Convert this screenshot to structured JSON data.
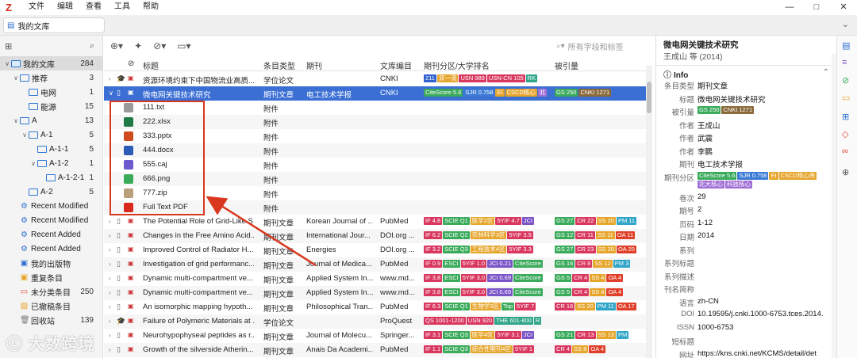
{
  "menubar": {
    "logo": "Z",
    "items": [
      "文件",
      "编辑",
      "查看",
      "工具",
      "帮助"
    ],
    "controls": [
      "—",
      "□",
      "✕"
    ]
  },
  "tab": {
    "label": "我的文库"
  },
  "left": {
    "collections": [
      {
        "label": "我的文库",
        "count": "284",
        "tw": "∨",
        "kind": "lib",
        "indent": 0,
        "sel": true
      },
      {
        "label": "推荐",
        "count": "3",
        "tw": "∨",
        "kind": "folder",
        "indent": 1
      },
      {
        "label": "电网",
        "count": "1",
        "tw": "",
        "kind": "folder",
        "indent": 2
      },
      {
        "label": "能源",
        "count": "15",
        "tw": "",
        "kind": "folder",
        "indent": 2
      },
      {
        "label": "A",
        "count": "13",
        "tw": "∨",
        "kind": "folder",
        "indent": 1
      },
      {
        "label": "A-1",
        "count": "5",
        "tw": "∨",
        "kind": "folder",
        "indent": 2
      },
      {
        "label": "A-1-1",
        "count": "5",
        "tw": "",
        "kind": "folder",
        "indent": 3
      },
      {
        "label": "A-1-2",
        "count": "1",
        "tw": "∨",
        "kind": "folder",
        "indent": 3
      },
      {
        "label": "A-1-2-1",
        "count": "1",
        "tw": "",
        "kind": "folder",
        "indent": 4
      },
      {
        "label": "A-2",
        "count": "5",
        "tw": "",
        "kind": "folder",
        "indent": 2
      },
      {
        "label": "Recent Modified",
        "count": "",
        "tw": "",
        "kind": "saved",
        "indent": 1
      },
      {
        "label": "Recent Modified",
        "count": "",
        "tw": "",
        "kind": "saved",
        "indent": 1
      },
      {
        "label": "Recent Added",
        "count": "",
        "tw": "",
        "kind": "saved",
        "indent": 1
      },
      {
        "label": "Recent Added",
        "count": "",
        "tw": "",
        "kind": "saved",
        "indent": 1
      },
      {
        "label": "我的出版物",
        "count": "",
        "tw": "",
        "kind": "pub",
        "indent": 1
      },
      {
        "label": "重复条目",
        "count": "",
        "tw": "",
        "kind": "dup",
        "indent": 1
      },
      {
        "label": "未分类条目",
        "count": "250",
        "tw": "",
        "kind": "unf",
        "indent": 1
      },
      {
        "label": "已撤稿条目",
        "count": "",
        "tw": "",
        "kind": "ret",
        "indent": 1
      },
      {
        "label": "回收站",
        "count": "139",
        "tw": "",
        "kind": "trash",
        "indent": 1
      }
    ]
  },
  "middle": {
    "search_placeholder": "所有字段和标签",
    "columns": {
      "title": "标题",
      "type": "条目类型",
      "journal": "期刊",
      "catalog": "文库编目",
      "rank": "期刊分区/大学排名",
      "cited": "被引量"
    },
    "rows": [
      {
        "kind": "item",
        "tw": "›",
        "title": "资源环境约束下中国物流业高质...",
        "type": "学位论文",
        "journal": "",
        "catalog": "CNKI",
        "rank": [
          [
            "211",
            "#2f5fd0"
          ],
          [
            "双一流",
            "#e6a52b"
          ],
          [
            "USN 989",
            "#d9375f"
          ],
          [
            "USN-CN 105",
            "#d9375f"
          ],
          [
            "RK",
            "#2fa58a"
          ]
        ],
        "cited": []
      },
      {
        "kind": "item",
        "tw": "∨",
        "sel": true,
        "title": "微电网关键技术研究",
        "type": "期刊文章",
        "journal": "电工技术学报",
        "catalog": "CNKI",
        "rank": [
          [
            "CiteScore 5.6",
            "#3aaa5b"
          ],
          [
            "SJR 0.758",
            "#3b7bd6"
          ],
          [
            "EI",
            "#e6a52b"
          ],
          [
            "CSCD核心",
            "#e6a52b"
          ],
          [
            "北",
            "#a06fd6"
          ]
        ],
        "cited": [
          [
            "GS 250",
            "#3aaa5b"
          ],
          [
            "CNKI 1271",
            "#8a6a3a"
          ]
        ]
      },
      {
        "kind": "att",
        "title": "111.txt",
        "type": "附件",
        "icon": "#9a9a9a"
      },
      {
        "kind": "att",
        "title": "222.xlsx",
        "type": "附件",
        "icon": "#1f7a46"
      },
      {
        "kind": "att",
        "title": "333.pptx",
        "type": "附件",
        "icon": "#d04a1f"
      },
      {
        "kind": "att",
        "title": "444.docx",
        "type": "附件",
        "icon": "#2b5cb8"
      },
      {
        "kind": "att",
        "title": "555.caj",
        "type": "附件",
        "icon": "#6a5acd"
      },
      {
        "kind": "att",
        "title": "666.png",
        "type": "附件",
        "icon": "#3aaa5b"
      },
      {
        "kind": "att",
        "title": "777.zip",
        "type": "附件",
        "icon": "#b8a07a"
      },
      {
        "kind": "att",
        "title": "Full Text PDF",
        "type": "附件",
        "icon": "#d9281e"
      },
      {
        "kind": "item",
        "tw": "›",
        "title": "The Potential Role of Grid-Like S...",
        "type": "期刊文章",
        "journal": "Korean Journal of ...",
        "catalog": "PubMed",
        "rank": [
          [
            "IF 4.8",
            "#d9375f"
          ],
          [
            "SCIE Q1",
            "#3aaa5b"
          ],
          [
            "医学2区",
            "#e6a52b"
          ],
          [
            "5YIF 4.7",
            "#d9375f"
          ],
          [
            "JCI",
            "#7a55c8"
          ]
        ],
        "cited": [
          [
            "GS 27",
            "#3aaa5b"
          ],
          [
            "CR 22",
            "#d9375f"
          ],
          [
            "SS 20",
            "#e6a52b"
          ],
          [
            "PM 11",
            "#2fa5c8"
          ]
        ]
      },
      {
        "kind": "item",
        "tw": "›",
        "title": "Changes in the Free Amino Acid...",
        "type": "期刊文章",
        "journal": "International Jour...",
        "catalog": "DOI.org ...",
        "rank": [
          [
            "IF 6.2",
            "#d9375f"
          ],
          [
            "SCIE Q2",
            "#3aaa5b"
          ],
          [
            "农林科学3区",
            "#e6a52b"
          ],
          [
            "5YIF 3.5",
            "#d9375f"
          ]
        ],
        "cited": [
          [
            "GS 12",
            "#3aaa5b"
          ],
          [
            "CR 11",
            "#d9375f"
          ],
          [
            "SS 11",
            "#e6a52b"
          ],
          [
            "OA 11",
            "#e0402a"
          ]
        ]
      },
      {
        "kind": "item",
        "tw": "›",
        "title": "Improved Control of Radiator H...",
        "type": "期刊文章",
        "journal": "Energies",
        "catalog": "DOI.org ...",
        "rank": [
          [
            "IF 3.2",
            "#d9375f"
          ],
          [
            "SCIE Q3",
            "#3aaa5b"
          ],
          [
            "工程技术4区",
            "#e6a52b"
          ],
          [
            "5YIF 3.3",
            "#d9375f"
          ]
        ],
        "cited": [
          [
            "GS 27",
            "#3aaa5b"
          ],
          [
            "CR 23",
            "#d9375f"
          ],
          [
            "SS 20",
            "#e6a52b"
          ],
          [
            "OA 20",
            "#e0402a"
          ]
        ]
      },
      {
        "kind": "item",
        "tw": "›",
        "title": "Investigation of grid performanc...",
        "type": "期刊文章",
        "journal": "Journal of Medica...",
        "catalog": "PubMed",
        "rank": [
          [
            "IF 0.9",
            "#d9375f"
          ],
          [
            "ESCI",
            "#3aaa5b"
          ],
          [
            "5YIF 1.0",
            "#d9375f"
          ],
          [
            "JCI 0.21",
            "#7a55c8"
          ],
          [
            "CiteScore",
            "#3aaa5b"
          ]
        ],
        "cited": [
          [
            "GS 16",
            "#3aaa5b"
          ],
          [
            "CR 8",
            "#d9375f"
          ],
          [
            "SS 12",
            "#e6a52b"
          ],
          [
            "PM 3",
            "#2fa5c8"
          ]
        ]
      },
      {
        "kind": "item",
        "tw": "›",
        "title": "Dynamic multi-compartment ve...",
        "type": "期刊文章",
        "journal": "Applied System In...",
        "catalog": "www.md...",
        "rank": [
          [
            "IF 3.8",
            "#d9375f"
          ],
          [
            "ESCI",
            "#3aaa5b"
          ],
          [
            "5YIF 3.0",
            "#d9375f"
          ],
          [
            "JCI 0.69",
            "#7a55c8"
          ],
          [
            "CiteScore",
            "#3aaa5b"
          ]
        ],
        "cited": [
          [
            "GS 5",
            "#3aaa5b"
          ],
          [
            "CR 4",
            "#d9375f"
          ],
          [
            "SS 4",
            "#e6a52b"
          ],
          [
            "OA 4",
            "#e0402a"
          ]
        ]
      },
      {
        "kind": "item",
        "tw": "›",
        "title": "Dynamic multi-compartment ve...",
        "type": "期刊文章",
        "journal": "Applied System In...",
        "catalog": "www.md...",
        "rank": [
          [
            "IF 3.8",
            "#d9375f"
          ],
          [
            "ESCI",
            "#3aaa5b"
          ],
          [
            "5YIF 3.0",
            "#d9375f"
          ],
          [
            "JCI 0.69",
            "#7a55c8"
          ],
          [
            "CiteScore",
            "#3aaa5b"
          ]
        ],
        "cited": [
          [
            "GS 5",
            "#3aaa5b"
          ],
          [
            "CR 4",
            "#d9375f"
          ],
          [
            "SS 4",
            "#e6a52b"
          ],
          [
            "OA 4",
            "#e0402a"
          ]
        ]
      },
      {
        "kind": "item",
        "tw": "›",
        "title": "An isomorphic mapping hypoth...",
        "type": "期刊文章",
        "journal": "Philosophical Tran...",
        "catalog": "PubMed",
        "rank": [
          [
            "IF 6.3",
            "#d9375f"
          ],
          [
            "SCIE Q1",
            "#3aaa5b"
          ],
          [
            "生物学3区",
            "#e6a52b"
          ],
          [
            "Top",
            "#3aaa5b"
          ],
          [
            "5YIF 7",
            "#d9375f"
          ]
        ],
        "cited": [
          [
            "CR 16",
            "#d9375f"
          ],
          [
            "SS 20",
            "#e6a52b"
          ],
          [
            "PM 11",
            "#2fa5c8"
          ],
          [
            "OA 17",
            "#e0402a"
          ]
        ]
      },
      {
        "kind": "item",
        "tw": "›",
        "title": "Failure of Polymeric Materials at ...",
        "type": "学位论文",
        "journal": "",
        "catalog": "ProQuest",
        "rank": [
          [
            "QS 1001-1200",
            "#d9375f"
          ],
          [
            "USN 920",
            "#d9375f"
          ],
          [
            "THE 601-800",
            "#2fa58a"
          ],
          [
            "R",
            "#2fa58a"
          ]
        ],
        "cited": []
      },
      {
        "kind": "item",
        "tw": "›",
        "title": "Neurohypophyseal peptides as r...",
        "type": "期刊文章",
        "journal": "Journal of Molecu...",
        "catalog": "Springer...",
        "rank": [
          [
            "IF 3.1",
            "#d9375f"
          ],
          [
            "SCIE Q3",
            "#3aaa5b"
          ],
          [
            "医学4区",
            "#e6a52b"
          ],
          [
            "5YIF 3.1",
            "#d9375f"
          ],
          [
            "JCI",
            "#7a55c8"
          ]
        ],
        "cited": [
          [
            "GS 21",
            "#3aaa5b"
          ],
          [
            "CR 13",
            "#d9375f"
          ],
          [
            "SS 13",
            "#e6a52b"
          ],
          [
            "PM",
            "#2fa5c8"
          ]
        ]
      },
      {
        "kind": "item",
        "tw": "›",
        "title": "Growth of the silverside Atherin...",
        "type": "期刊文章",
        "journal": "Anais Da Academi...",
        "catalog": "PubMed",
        "rank": [
          [
            "IF 1.1",
            "#d9375f"
          ],
          [
            "SCIE Q3",
            "#3aaa5b"
          ],
          [
            "综合性期刊4区",
            "#e6a52b"
          ],
          [
            "5YIF 1",
            "#d9375f"
          ]
        ],
        "cited": [
          [
            "CR 4",
            "#d9375f"
          ],
          [
            "SS 8",
            "#e6a52b"
          ],
          [
            "OA 4",
            "#e0402a"
          ]
        ]
      }
    ]
  },
  "right": {
    "title": "微电网关键技术研究",
    "subtitle": "王成山 等 (2014)",
    "section": "Info",
    "fields": [
      {
        "k": "条目类型",
        "v": "期刊文章"
      },
      {
        "k": "标题",
        "v": "微电网关键技术研究"
      },
      {
        "k": "被引量",
        "v": "",
        "badges": [
          [
            "GS 250",
            "#3aaa5b"
          ],
          [
            "CNKI 1271",
            "#8a6a3a"
          ]
        ]
      },
      {
        "k": "作者",
        "v": "王成山"
      },
      {
        "k": "作者",
        "v": "武震"
      },
      {
        "k": "作者",
        "v": "李鹏"
      },
      {
        "k": "期刊",
        "v": "电工技术学报"
      },
      {
        "k": "期刊分区",
        "v": "",
        "badges": [
          [
            "CiteScore 5.6",
            "#3aaa5b"
          ],
          [
            "SJR 0.758",
            "#3b7bd6"
          ],
          [
            "EI",
            "#e6a52b"
          ],
          [
            "CSCD核心库",
            "#e6a52b"
          ]
        ],
        "badges2": [
          [
            "北大核心",
            "#a06fd6"
          ],
          [
            "科技核心",
            "#a06fd6"
          ]
        ]
      },
      {
        "k": "卷次",
        "v": "29"
      },
      {
        "k": "期号",
        "v": "2"
      },
      {
        "k": "页码",
        "v": "1-12"
      },
      {
        "k": "日期",
        "v": "2014"
      },
      {
        "k": "系列",
        "v": ""
      },
      {
        "k": "系列标题",
        "v": ""
      },
      {
        "k": "系列描述",
        "v": ""
      },
      {
        "k": "刊名简称",
        "v": ""
      },
      {
        "k": "语言",
        "v": "zh-CN"
      },
      {
        "k": "DOI",
        "v": "10.19595/j.cnki.1000-6753.tces.2014."
      },
      {
        "k": "ISSN",
        "v": "1000-6753"
      },
      {
        "k": "短标题",
        "v": ""
      },
      {
        "k": "网址",
        "v": "https://kns.cnki.net/KCMS/detail/det"
      }
    ]
  },
  "watermark": "大数跨境"
}
